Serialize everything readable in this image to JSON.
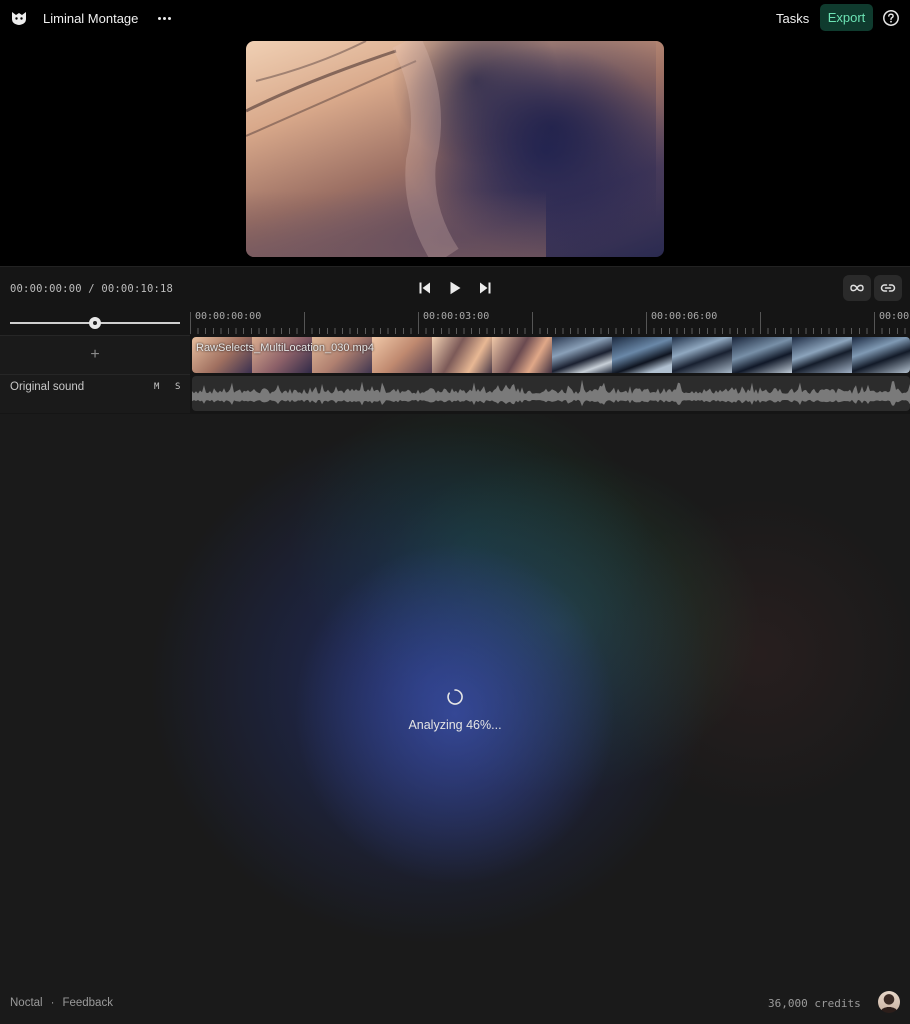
{
  "header": {
    "project_title": "Liminal Montage",
    "tasks_label": "Tasks",
    "export_label": "Export",
    "icons": [
      "logo-icon",
      "more-icon",
      "help-icon"
    ]
  },
  "preview": {
    "media": "video-preview-frame"
  },
  "transport": {
    "current_time": "00:00:00:00",
    "separator": "/",
    "duration": "00:00:10:18",
    "icons": [
      "skip-back-icon",
      "play-icon",
      "skip-forward-icon",
      "loop-icon",
      "link-icon"
    ]
  },
  "timeline": {
    "zoom_level": 0.5,
    "ruler_labels": [
      "00:00:00:00",
      "00:00:03:00",
      "00:00:06:00",
      "00:00"
    ],
    "video_track": {
      "add_label": "+",
      "clip_name": "RawSelects_MultiLocation_030.mp4"
    },
    "audio_track": {
      "label": "Original sound",
      "mute_label": "M",
      "solo_label": "S"
    }
  },
  "status": {
    "text": "Analyzing 46%...",
    "progress_percent": 46
  },
  "footer": {
    "brand": "Noctal",
    "separator": "·",
    "feedback_label": "Feedback",
    "credits": "36,000 credits"
  },
  "colors": {
    "accent_bg": "#0f3b2e",
    "accent_text": "#6ce3b4"
  }
}
